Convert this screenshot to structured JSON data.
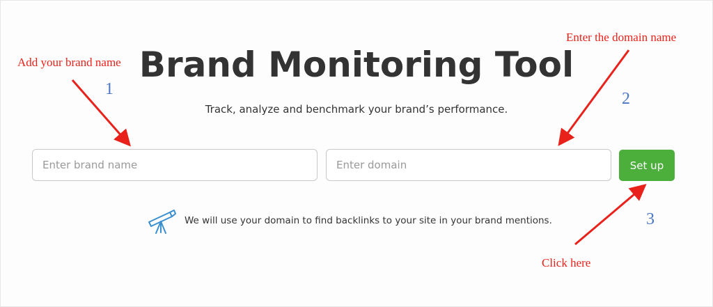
{
  "header": {
    "title": "Brand Monitoring Tool",
    "subtitle": "Track, analyze and benchmark your brand’s performance."
  },
  "form": {
    "brand_placeholder": "Enter brand name",
    "domain_placeholder": "Enter domain",
    "setup_label": "Set up"
  },
  "note": {
    "icon": "telescope-icon",
    "text": "We will use your domain to find backlinks to your site in your brand mentions."
  },
  "annotations": {
    "brand_label": "Add your brand name",
    "domain_label": "Enter the domain name",
    "click_label": "Click here",
    "step_1": "1",
    "step_2": "2",
    "step_3": "3"
  },
  "colors": {
    "button": "#4caf3c",
    "annotation": "#e8221b",
    "step_number": "#4a76c6",
    "icon": "#3a8fd0"
  }
}
